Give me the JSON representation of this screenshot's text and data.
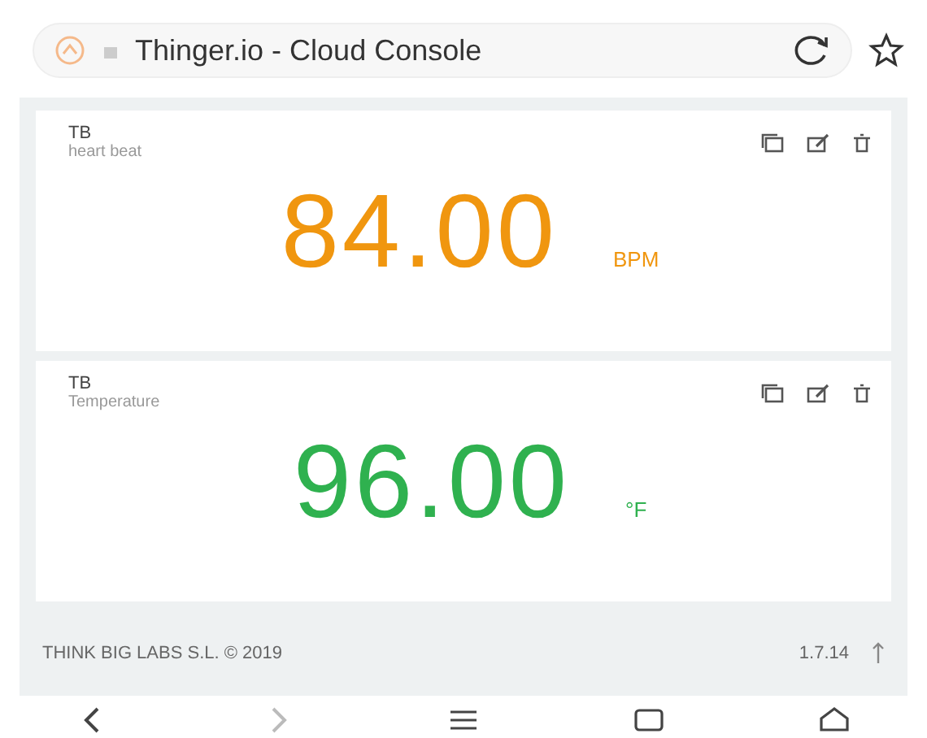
{
  "browser": {
    "title": "Thinger.io - Cloud Console"
  },
  "widgets": [
    {
      "device": "TB",
      "label": "heart beat",
      "value": "84.00",
      "unit": "BPM",
      "color": "#f0960f"
    },
    {
      "device": "TB",
      "label": "Temperature",
      "value": "96.00",
      "unit": "°F",
      "color": "#2fb14f"
    }
  ],
  "footer": {
    "company": "THINK BIG LABS S.L. © 2019",
    "version": "1.7.14"
  },
  "nav": [
    {
      "kind": "back",
      "disabled": false
    },
    {
      "kind": "forward",
      "disabled": true
    },
    {
      "kind": "menu",
      "disabled": false
    },
    {
      "kind": "tabs",
      "disabled": false
    },
    {
      "kind": "home",
      "disabled": false
    }
  ]
}
